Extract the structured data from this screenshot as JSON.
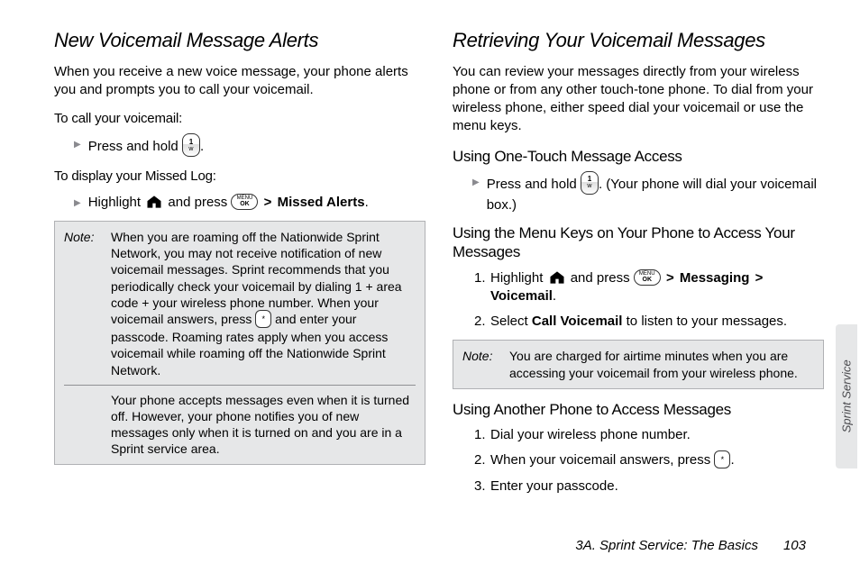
{
  "left": {
    "heading": "New Voicemail Message Alerts",
    "intro": "When you receive a new voice message, your phone alerts you and prompts you to call your voicemail.",
    "sub1": "To call your voicemail:",
    "bullet1_pre": "Press and hold ",
    "bullet1_post": ".",
    "sub2": "To display your Missed Log:",
    "bullet2_pre": "Highlight ",
    "bullet2_mid": " and press ",
    "bullet2_sep": ">",
    "bullet2_bold": "Missed Alerts",
    "bullet2_post": ".",
    "note_label": "Note:",
    "note1": "When you are roaming off the Nationwide Sprint Network, you may not receive notification of new voicemail messages. Sprint recommends that you periodically check your voicemail by dialing 1 + area code + your wireless phone number. When your voicemail answers, press ",
    "note1b": " and enter your passcode. Roaming rates apply when you access voicemail while roaming off the Nationwide Sprint Network.",
    "note2": "Your phone accepts messages even when it is turned off. However, your phone notifies you of new messages only when it is turned on and you are in a Sprint service area."
  },
  "right": {
    "heading": "Retrieving Your Voicemail Messages",
    "intro": "You can review your messages directly from your wireless phone or from any other touch-tone phone. To dial from your wireless phone, either speed dial your voicemail or use the menu keys.",
    "sub1": "Using One-Touch Message Access",
    "bullet1_pre": "Press and hold ",
    "bullet1_post": ". (Your phone will dial your voicemail box.)",
    "sub2": "Using the Menu Keys on Your Phone to Access Your Messages",
    "step1_pre": "Highlight ",
    "step1_mid": " and press ",
    "sep": ">",
    "step1_b1": "Messaging",
    "step1_b2": "Voicemail",
    "step1_post": ".",
    "step2_pre": "Select ",
    "step2_bold": "Call Voicemail",
    "step2_post": " to listen to your messages.",
    "note_label": "Note:",
    "note": "You are charged for airtime minutes when you are accessing your voicemail from your wireless phone.",
    "sub3": "Using Another Phone to Access Messages",
    "s3_1": "Dial your wireless phone number.",
    "s3_2_pre": "When your voicemail answers, press ",
    "s3_2_post": ".",
    "s3_3": "Enter your passcode."
  },
  "footer": {
    "section": "3A. Sprint Service: The Basics",
    "page": "103"
  },
  "side_tab": "Sprint Service",
  "icons": {
    "one_key_top": "1",
    "one_key_bot": "w",
    "ok_top": "MENU",
    "ok_bot": "OK",
    "star": "*"
  }
}
